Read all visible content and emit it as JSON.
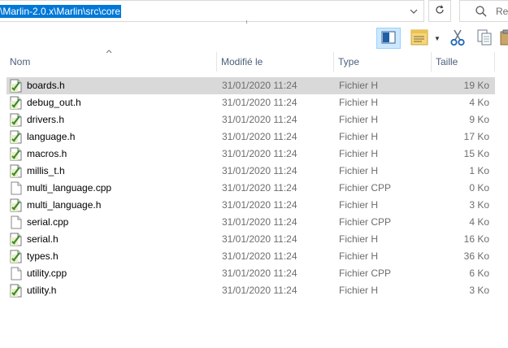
{
  "address_bar": {
    "path": "\\Marlin-2.0.x\\Marlin\\src\\core"
  },
  "search": {
    "placeholder": "Rec"
  },
  "columns": {
    "name": "Nom",
    "modified": "Modifié le",
    "type": "Type",
    "size": "Taille"
  },
  "files": [
    {
      "name": "boards.h",
      "modified": "31/01/2020 11:24",
      "type": "Fichier H",
      "size": "19 Ko",
      "icon": "h-file-icon",
      "selected": true
    },
    {
      "name": "debug_out.h",
      "modified": "31/01/2020 11:24",
      "type": "Fichier H",
      "size": "4 Ko",
      "icon": "h-file-icon"
    },
    {
      "name": "drivers.h",
      "modified": "31/01/2020 11:24",
      "type": "Fichier H",
      "size": "9 Ko",
      "icon": "h-file-icon"
    },
    {
      "name": "language.h",
      "modified": "31/01/2020 11:24",
      "type": "Fichier H",
      "size": "17 Ko",
      "icon": "h-file-icon"
    },
    {
      "name": "macros.h",
      "modified": "31/01/2020 11:24",
      "type": "Fichier H",
      "size": "15 Ko",
      "icon": "h-file-icon"
    },
    {
      "name": "millis_t.h",
      "modified": "31/01/2020 11:24",
      "type": "Fichier H",
      "size": "1 Ko",
      "icon": "h-file-icon"
    },
    {
      "name": "multi_language.cpp",
      "modified": "31/01/2020 11:24",
      "type": "Fichier CPP",
      "size": "0 Ko",
      "icon": "cpp-file-icon"
    },
    {
      "name": "multi_language.h",
      "modified": "31/01/2020 11:24",
      "type": "Fichier H",
      "size": "3 Ko",
      "icon": "h-file-icon"
    },
    {
      "name": "serial.cpp",
      "modified": "31/01/2020 11:24",
      "type": "Fichier CPP",
      "size": "4 Ko",
      "icon": "cpp-file-icon"
    },
    {
      "name": "serial.h",
      "modified": "31/01/2020 11:24",
      "type": "Fichier H",
      "size": "16 Ko",
      "icon": "h-file-icon"
    },
    {
      "name": "types.h",
      "modified": "31/01/2020 11:24",
      "type": "Fichier H",
      "size": "36 Ko",
      "icon": "h-file-icon"
    },
    {
      "name": "utility.cpp",
      "modified": "31/01/2020 11:24",
      "type": "Fichier CPP",
      "size": "6 Ko",
      "icon": "cpp-file-icon"
    },
    {
      "name": "utility.h",
      "modified": "31/01/2020 11:24",
      "type": "Fichier H",
      "size": "3 Ko",
      "icon": "h-file-icon"
    }
  ],
  "colors": {
    "selection": "#0078d7",
    "row_selected": "#d9d9d9",
    "header_text": "#4c607a"
  }
}
